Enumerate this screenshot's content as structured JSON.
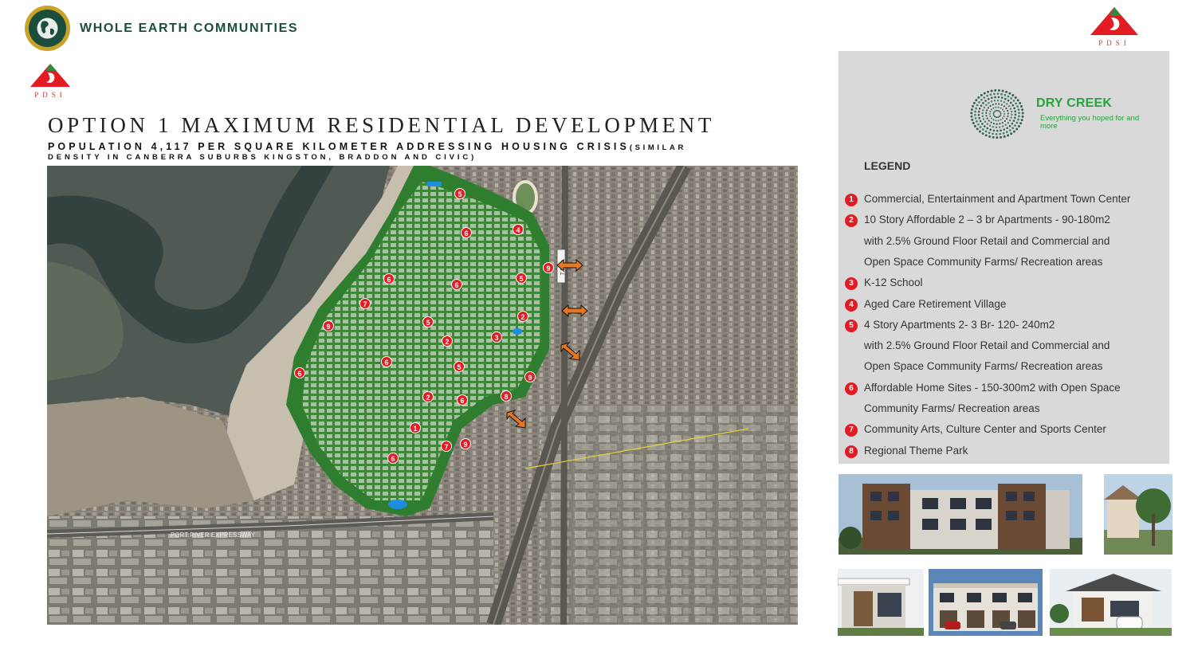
{
  "header": {
    "company_name": "WHOLE EARTH COMMUNITIES",
    "pdsi_mark": "PDSI"
  },
  "title": "OPTION 1 MAXIMUM RESIDENTIAL DEVELOPMENT",
  "subtitle_main": "POPULATION 4,117 PER SQUARE KILOMETER ADDRESSING HOUSING CRISIS",
  "subtitle_paren_start": "(SIMILAR",
  "subtitle_line2": "DENSITY IN CANBERRA SUBURBS KINGSTON, BRADDON AND CIVIC)",
  "map": {
    "road_label": "PORT RIVER EXPRESSWAY",
    "road_sign": "7.8km",
    "markers": [
      "5",
      "6",
      "4",
      "9",
      "6",
      "6",
      "5",
      "7",
      "9",
      "5",
      "2",
      "3",
      "2",
      "6",
      "6",
      "5",
      "9",
      "8",
      "2",
      "6",
      "1",
      "7",
      "9",
      "6"
    ],
    "marker_color": "#e31b23",
    "arrow_color": "#e87722"
  },
  "legend_panel": {
    "brand_name": "DRY CREEK",
    "brand_tagline": "Everything you hoped for and more",
    "brand_color": "#27a33a",
    "title": "LEGEND",
    "items": [
      {
        "num": "1",
        "lines": [
          "Commercial, Entertainment and Apartment Town Center"
        ]
      },
      {
        "num": "2",
        "lines": [
          "10 Story Affordable 2 – 3 br Apartments -  90-180m2",
          "with 2.5% Ground Floor Retail and Commercial and",
          "Open Space  Community Farms/ Recreation areas"
        ]
      },
      {
        "num": "3",
        "lines": [
          "K-12 School"
        ]
      },
      {
        "num": "4",
        "lines": [
          "Aged Care Retirement Village"
        ]
      },
      {
        "num": "5",
        "lines": [
          "4 Story  Apartments 2- 3 Br- 120- 240m2",
          "with 2.5% Ground Floor Retail and Commercial and",
          "Open Space  Community Farms/ Recreation areas"
        ]
      },
      {
        "num": "6",
        "lines": [
          "Affordable Home Sites - 150-300m2 with Open Space",
          "Community Farms/ Recreation areas"
        ]
      },
      {
        "num": "7",
        "lines": [
          "Community Arts, Culture Center and Sports Center"
        ]
      },
      {
        "num": "8",
        "lines": [
          "Regional Theme Park"
        ]
      }
    ]
  },
  "photos": [
    "apartment-building-photo",
    "townhouse-photo-partial",
    "modern-house-photo",
    "terrace-houses-photo",
    "single-house-photo"
  ]
}
